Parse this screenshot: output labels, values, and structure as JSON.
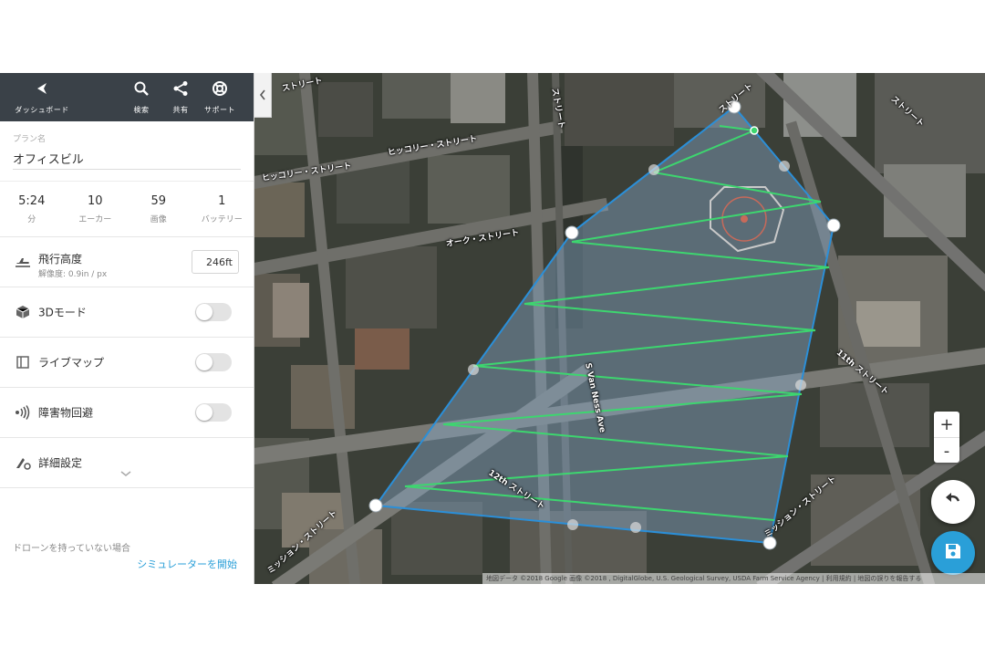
{
  "toolbar": {
    "dashboard_label": "ダッシュボード",
    "search_label": "検索",
    "share_label": "共有",
    "support_label": "サポート"
  },
  "plan": {
    "label": "プラン名",
    "name": "オフィスビル"
  },
  "stats": [
    {
      "value": "5:24",
      "label": "分"
    },
    {
      "value": "10",
      "label": "エーカー"
    },
    {
      "value": "59",
      "label": "画像"
    },
    {
      "value": "1",
      "label": "バッテリー"
    }
  ],
  "altitude": {
    "title": "飛行高度",
    "resolution": "解像度: 0.9in / px",
    "value": "246ft"
  },
  "options": {
    "mode_3d": {
      "label": "3Dモード",
      "enabled": false
    },
    "live_map": {
      "label": "ライブマップ",
      "enabled": false
    },
    "obstacle": {
      "label": "障害物回避",
      "enabled": false
    },
    "advanced_label": "詳細設定"
  },
  "footer": {
    "no_drone": "ドローンを持っていない場合",
    "simulator_link": "シミュレーターを開始"
  },
  "map": {
    "zoom_in": "+",
    "zoom_out": "-",
    "attribution": "地図データ ©2018 Google 画像 ©2018 , DigitalGlobe, U.S. Geological Survey, USDA Farm Service Agency | 利用規約 | 地図の誤りを報告する",
    "streets": {
      "hickory_1": "ヒッコリー・ストリート",
      "hickory_2": "ヒッコリー・ストリート",
      "oak": "オーク・ストリート",
      "van_ness": "S Van Ness Ave",
      "twelfth": "12th ストリート",
      "eleventh": "11th ストリート",
      "mission_1": "ミッション・ストリート",
      "mission_2": "ミッション・ストリート",
      "top_right": "ストリート",
      "top_left": "ストリート",
      "top_mid": "ストリート",
      "vertical": "ストリート"
    }
  },
  "colors": {
    "toolbar_bg": "#3a4148",
    "accent": "#2a9fd8",
    "boundary": "#2b8fd8",
    "flight_lines": "#3dd66f"
  }
}
